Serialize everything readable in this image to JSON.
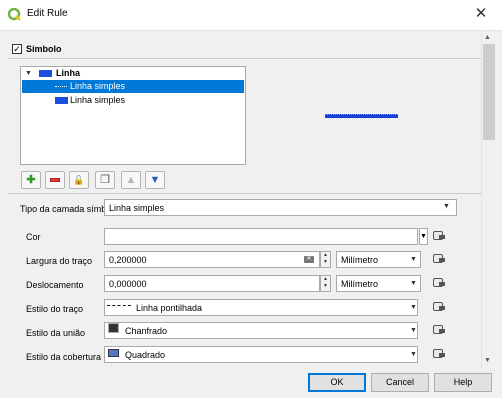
{
  "window": {
    "title": "Edit Rule",
    "close_glyph": "✕"
  },
  "symbol_group": {
    "label": "Símbolo",
    "checked": true,
    "check_glyph": "✓"
  },
  "tree": {
    "root_label": "Linha",
    "selected_label": "Linha simples",
    "second_label": "Linha simples",
    "expand_glyph": "▼"
  },
  "toolbar": {
    "add_icon": "plus-icon",
    "remove_icon": "minus-icon",
    "lock_icon": "lock-icon",
    "duplicate_icon": "duplicate-icon",
    "up_icon": "arrow-up-icon",
    "down_icon": "arrow-down-icon",
    "add_glyph": "✚",
    "lock_glyph": "🔓",
    "dup_glyph": "❐",
    "up_glyph": "▲",
    "down_glyph": "▼"
  },
  "layer_type": {
    "label": "Tipo da camada símbolo",
    "value": "Linha simples"
  },
  "properties": {
    "color_label": "Cor",
    "width_label": "Largura do traço",
    "width_value": "0,200000",
    "width_unit": "Milímetro",
    "offset_label": "Deslocamento",
    "offset_value": "0,000000",
    "offset_unit": "Milímetro",
    "stroke_style_label": "Estilo do traço",
    "stroke_style_value": "Linha pontilhada",
    "join_style_label": "Estilo da união",
    "join_style_value": "Chanfrado",
    "cap_style_label": "Estilo da cobertura",
    "cap_style_value": "Quadrado"
  },
  "glyphs": {
    "combo_arrow": "▼",
    "spin_up": "▲",
    "spin_down": "▼",
    "clear": "✕"
  },
  "buttons": {
    "ok": "OK",
    "cancel": "Cancel",
    "help": "Help"
  },
  "colors": {
    "accent": "#0078d7",
    "symbol_blue": "#1a4fe0"
  }
}
